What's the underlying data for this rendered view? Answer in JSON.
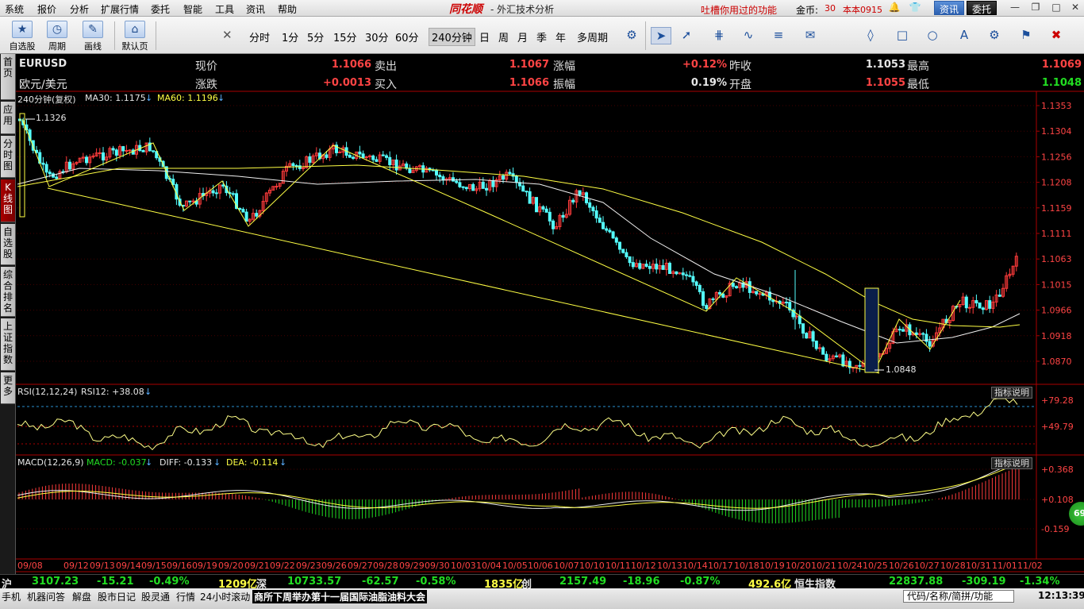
{
  "menu": {
    "items": [
      "系统",
      "报价",
      "分析",
      "扩展行情",
      "委托",
      "智能",
      "工具",
      "资讯",
      "帮助"
    ],
    "brand": "同花顺",
    "brand_sub": "- 外汇技术分析",
    "tip": "吐槽你用过的功能",
    "coin_label": "金币:",
    "coin_value": "30",
    "version": "本本0915",
    "btn_news": "资讯",
    "btn_trade": "委托"
  },
  "toolbar": {
    "buttons": [
      "自选股",
      "周期",
      "画线",
      "默认页"
    ],
    "periods": [
      "分时",
      "1分",
      "5分",
      "15分",
      "30分",
      "60分",
      "240分钟",
      "日",
      "周",
      "月",
      "季",
      "年",
      "多周期"
    ],
    "selected_period": "240分钟"
  },
  "tabs": [
    "首页",
    "应用",
    "分时图",
    "K线图",
    "自选股",
    "综合排名",
    "上证指数",
    "更多"
  ],
  "active_tab": "K线图",
  "quote": {
    "code": "EURUSD",
    "name": "欧元/美元",
    "rows": [
      [
        {
          "l": "现价",
          "v": "1.1066",
          "c": "red"
        },
        {
          "l": "卖出",
          "v": "1.1067",
          "c": "red"
        },
        {
          "l": "涨幅",
          "v": "+0.12%",
          "c": "red"
        },
        {
          "l": "昨收",
          "v": "1.1053",
          "c": "wht"
        },
        {
          "l": "最高",
          "v": "1.1069",
          "c": "red"
        }
      ],
      [
        {
          "l": "涨跌",
          "v": "+0.0013",
          "c": "red"
        },
        {
          "l": "买入",
          "v": "1.1066",
          "c": "red"
        },
        {
          "l": "振幅",
          "v": "0.19%",
          "c": "wht"
        },
        {
          "l": "开盘",
          "v": "1.1055",
          "c": "red"
        },
        {
          "l": "最低",
          "v": "1.1048",
          "c": "grn"
        }
      ]
    ]
  },
  "kline": {
    "title": "240分钟(复权)",
    "ma30": "MA30: 1.1175",
    "ma60": "MA60: 1.1196",
    "high_mark": "1.1326",
    "low_mark": "1.0848",
    "y_ticks": [
      "1.1353",
      "1.1304",
      "1.1256",
      "1.1208",
      "1.1159",
      "1.1111",
      "1.1063",
      "1.1015",
      "1.0966",
      "1.0918",
      "1.0870"
    ]
  },
  "rsi": {
    "title": "RSI(12,12,24)",
    "value": "RSI12: +38.08",
    "explain": "指标说明",
    "y_ticks": [
      "+79.28",
      "+49.79"
    ]
  },
  "macd": {
    "title": "MACD(12,26,9)",
    "macd": "MACD: -0.037",
    "diff": "DIFF: -0.133",
    "dea": "DEA: -0.114",
    "explain": "指标说明",
    "y_ticks": [
      "+0.368",
      "+0.108",
      "-0.159"
    ]
  },
  "x_labels": [
    "09/08",
    "09/12",
    "09/13",
    "09/14",
    "09/15",
    "09/16",
    "09/19",
    "09/20",
    "09/21",
    "09/22",
    "09/23",
    "09/26",
    "09/27",
    "09/28",
    "09/29",
    "09/30",
    "10/03",
    "10/04",
    "10/05",
    "10/06",
    "10/07",
    "10/10",
    "10/11",
    "10/12",
    "10/13",
    "10/14",
    "10/17",
    "10/18",
    "10/19",
    "10/20",
    "10/21",
    "10/24",
    "10/25",
    "10/26",
    "10/27",
    "10/28",
    "10/31",
    "11/01",
    "11/02"
  ],
  "index_bar": [
    {
      "t": "沪",
      "c": "wht"
    },
    {
      "t": "3107.23",
      "c": "grn"
    },
    {
      "t": "-15.21",
      "c": "grn"
    },
    {
      "t": "-0.49%",
      "c": "grn"
    },
    {
      "t": "1209亿",
      "c": "yel"
    },
    {
      "t": "深",
      "c": "wht"
    },
    {
      "t": "10733.57",
      "c": "grn"
    },
    {
      "t": "-62.57",
      "c": "grn"
    },
    {
      "t": "-0.58%",
      "c": "grn"
    },
    {
      "t": "1835亿",
      "c": "yel"
    },
    {
      "t": "创",
      "c": "wht"
    },
    {
      "t": "2157.49",
      "c": "grn"
    },
    {
      "t": "-18.96",
      "c": "grn"
    },
    {
      "t": "-0.87%",
      "c": "grn"
    },
    {
      "t": "492.6亿",
      "c": "yel"
    },
    {
      "t": "恒生指数",
      "c": "wht"
    },
    {
      "t": "22837.88",
      "c": "grn"
    },
    {
      "t": "-309.19",
      "c": "grn"
    },
    {
      "t": "-1.34%",
      "c": "grn"
    }
  ],
  "status": {
    "items": [
      "手机",
      "机器问答",
      "解盘",
      "股市日记",
      "股灵通",
      "行情",
      "24小时滚动"
    ],
    "ticker": "商所下周举办第十一届国际油脂油料大会",
    "code_box": "代码/名称/简拼/功能",
    "clock": "12:13:39",
    "badge": "69"
  }
}
